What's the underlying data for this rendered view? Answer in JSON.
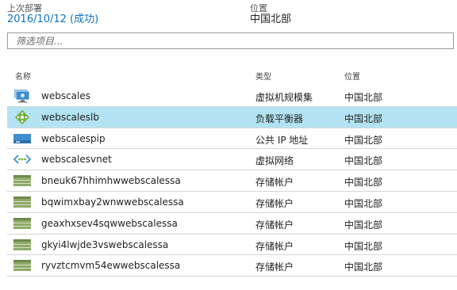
{
  "deployment": {
    "label": "上次部署",
    "value": "2016/10/12 (成功)"
  },
  "location": {
    "label": "位置",
    "value": "中国北部"
  },
  "filter": {
    "placeholder": "筛选项目..."
  },
  "columns": {
    "name": "名称",
    "type": "类型",
    "location": "位置"
  },
  "colors": {
    "link": "#0d72c0",
    "selected_row": "#b3e3f3"
  },
  "resources": [
    {
      "name": "webscales",
      "type": "虚拟机规模集",
      "location": "中国北部",
      "icon": "vm-scale-set-icon",
      "selected": false
    },
    {
      "name": "webscaleslb",
      "type": "负载平衡器",
      "location": "中国北部",
      "icon": "load-balancer-icon",
      "selected": true
    },
    {
      "name": "webscalespip",
      "type": "公共 IP 地址",
      "location": "中国北部",
      "icon": "public-ip-icon",
      "selected": false
    },
    {
      "name": "webscalesvnet",
      "type": "虚拟网络",
      "location": "中国北部",
      "icon": "virtual-network-icon",
      "selected": false
    },
    {
      "name": "bneuk67hhimhwwebscalessa",
      "type": "存储帐户",
      "location": "中国北部",
      "icon": "storage-account-icon",
      "selected": false
    },
    {
      "name": "bqwimxbay2wnwwebscalessa",
      "type": "存储帐户",
      "location": "中国北部",
      "icon": "storage-account-icon",
      "selected": false
    },
    {
      "name": "geaxhxsev4sqwwebscalessa",
      "type": "存储帐户",
      "location": "中国北部",
      "icon": "storage-account-icon",
      "selected": false
    },
    {
      "name": "gkyi4lwjde3vswebscalessa",
      "type": "存储帐户",
      "location": "中国北部",
      "icon": "storage-account-icon",
      "selected": false
    },
    {
      "name": "ryvztcmvm54ewwebscalessa",
      "type": "存储帐户",
      "location": "中国北部",
      "icon": "storage-account-icon",
      "selected": false
    }
  ]
}
